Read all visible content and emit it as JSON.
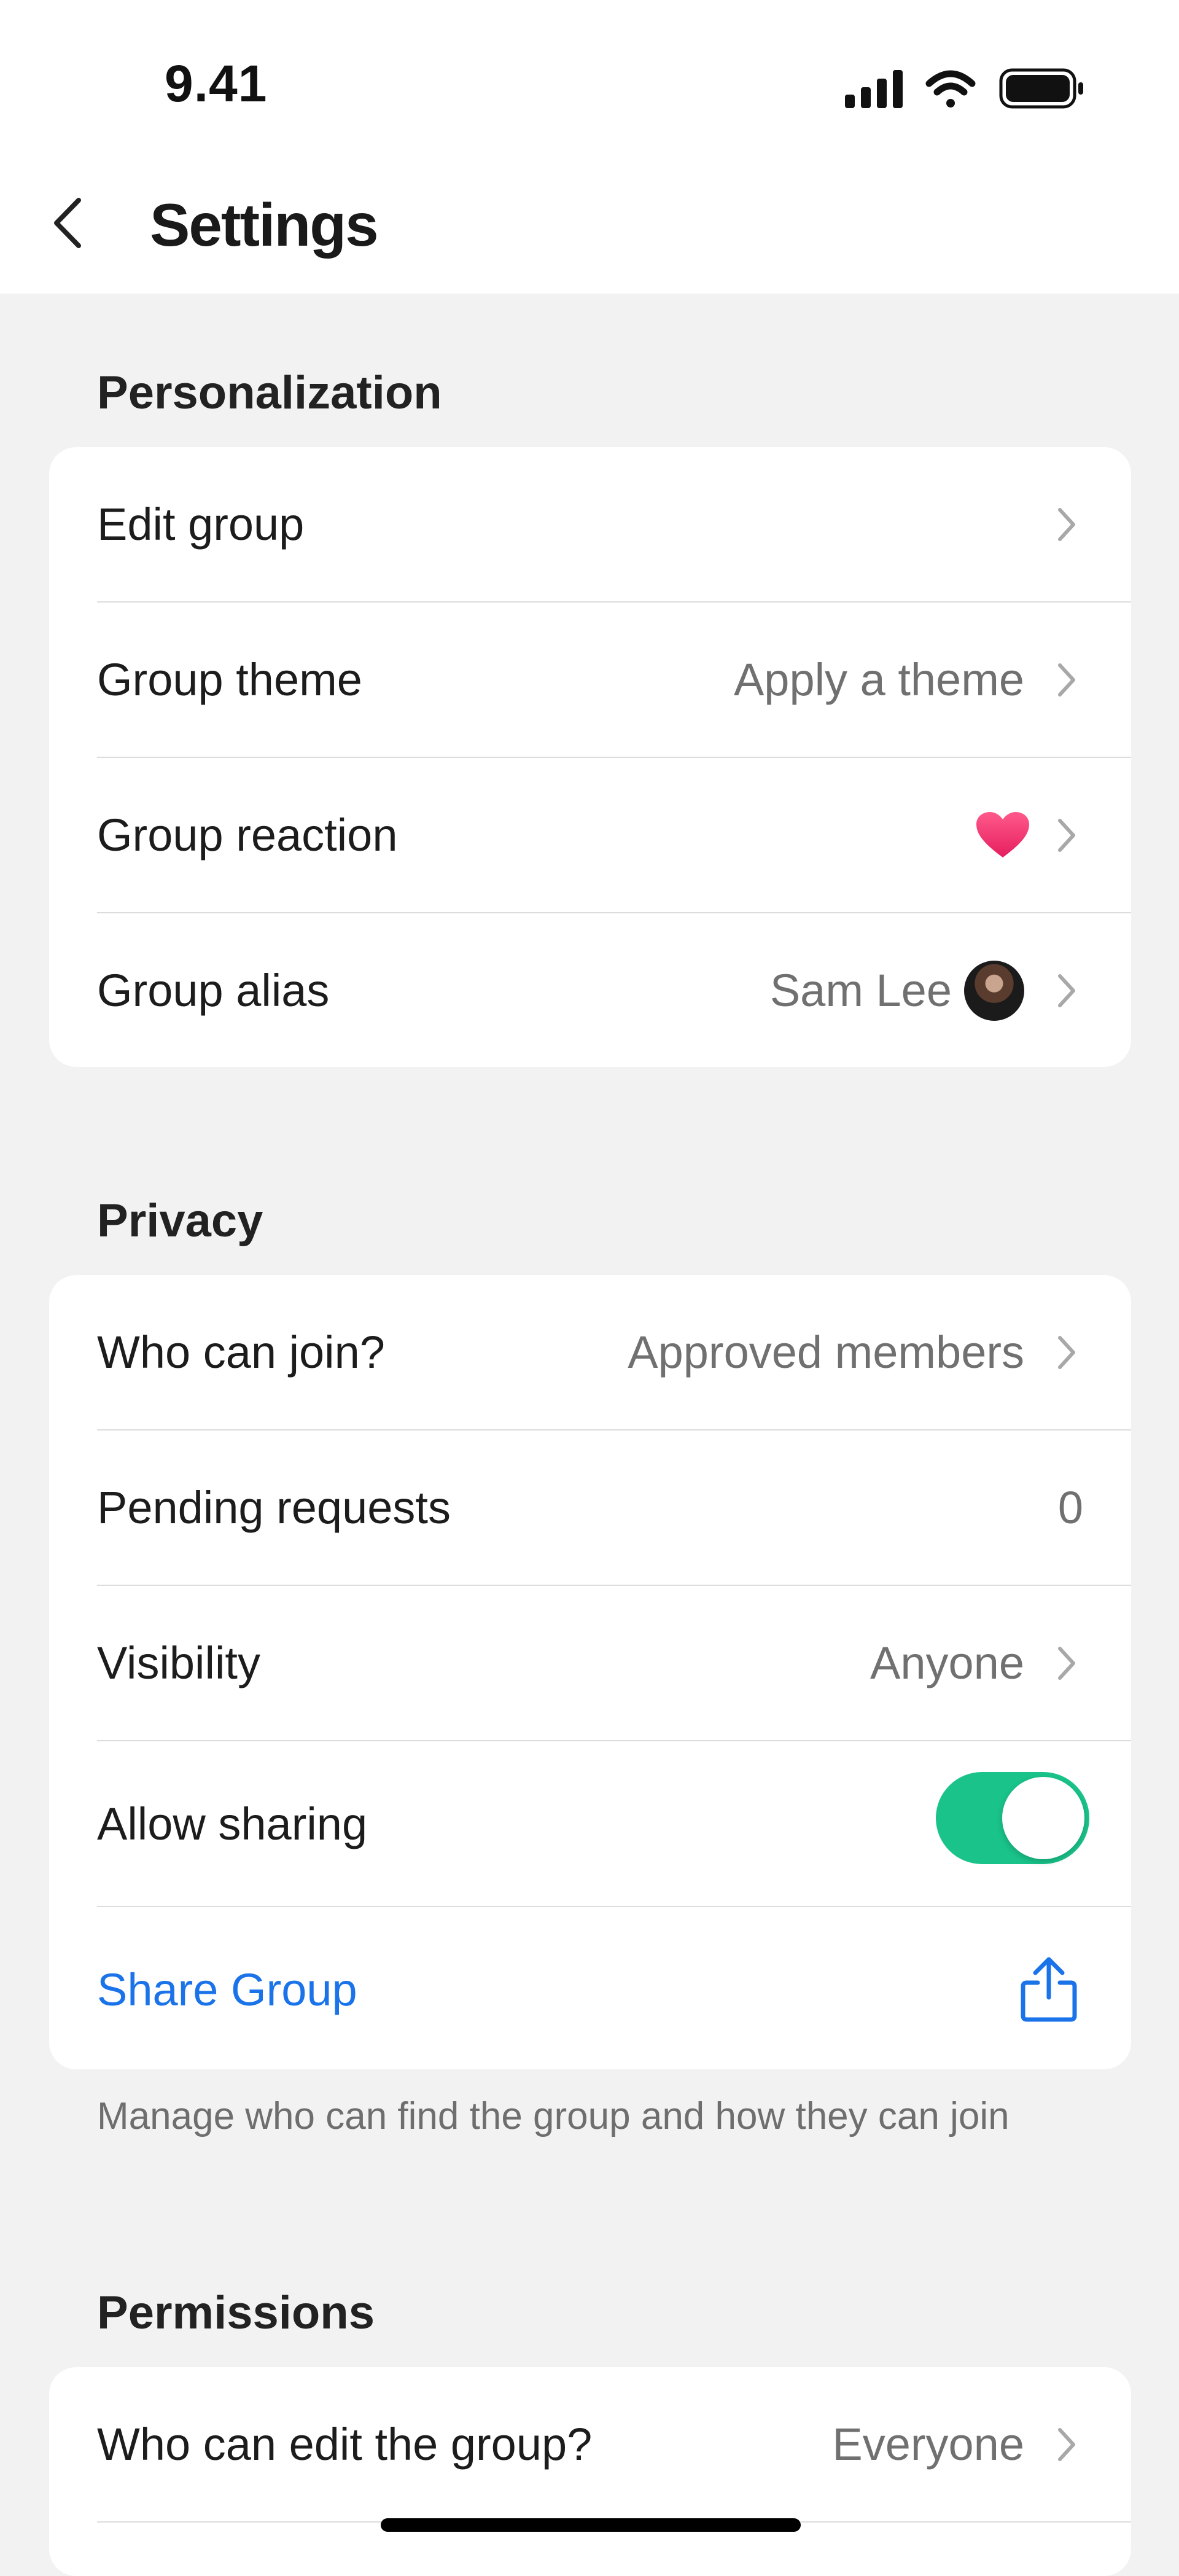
{
  "status_bar": {
    "time": "9.41"
  },
  "header": {
    "title": "Settings"
  },
  "sections": {
    "personalization": {
      "title": "Personalization",
      "rows": {
        "edit_group": {
          "label": "Edit group"
        },
        "group_theme": {
          "label": "Group theme",
          "value": "Apply a theme"
        },
        "group_reaction": {
          "label": "Group reaction",
          "value_icon": "heart-icon"
        },
        "group_alias": {
          "label": "Group alias",
          "value": "Sam Lee"
        }
      }
    },
    "privacy": {
      "title": "Privacy",
      "rows": {
        "who_can_join": {
          "label": "Who can join?",
          "value": "Approved members"
        },
        "pending_requests": {
          "label": "Pending requests",
          "value": "0"
        },
        "visibility": {
          "label": "Visibility",
          "value": "Anyone"
        },
        "allow_sharing": {
          "label": "Allow sharing",
          "enabled": true
        },
        "share_group": {
          "label": "Share Group"
        }
      },
      "note": "Manage who can find the group and how they can join"
    },
    "permissions": {
      "title": "Permissions",
      "rows": {
        "who_can_edit": {
          "label": "Who can edit the group?",
          "value": "Everyone"
        }
      }
    }
  },
  "colors": {
    "accent_link": "#1a73e8",
    "toggle_on": "#19c389",
    "heart": "#f0386b"
  }
}
